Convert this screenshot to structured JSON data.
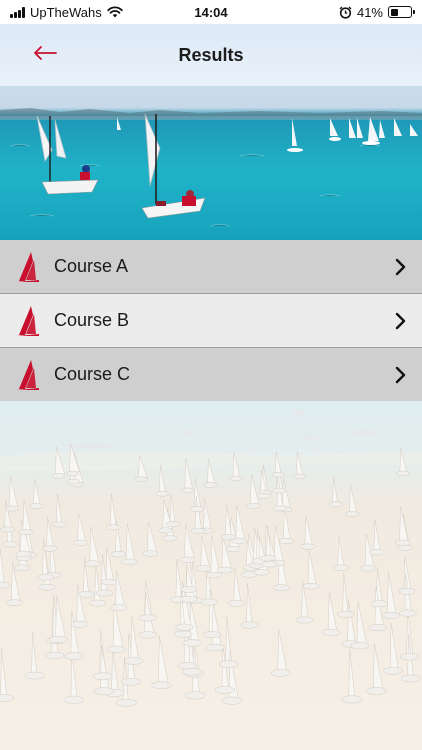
{
  "status_bar": {
    "carrier": "UpTheWahs",
    "time": "14:04",
    "battery": "41%",
    "battery_level": 0.41,
    "signal_icon": "signal-icon",
    "wifi_icon": "wifi-icon",
    "alarm_icon": "alarm-icon",
    "battery_icon": "battery-icon"
  },
  "nav": {
    "title": "Results",
    "back_icon": "arrow-left-icon",
    "accent": "#c8102e"
  },
  "courses": [
    {
      "label": "Course A",
      "icon": "sail-logo-icon",
      "chevron": "chevron-right-icon"
    },
    {
      "label": "Course B",
      "icon": "sail-logo-icon",
      "chevron": "chevron-right-icon"
    },
    {
      "label": "Course C",
      "icon": "sail-logo-icon",
      "chevron": "chevron-right-icon"
    }
  ],
  "colors": {
    "brand_red": "#c8102e",
    "row_dark": "#cfcfcf",
    "row_light": "#ececec"
  }
}
